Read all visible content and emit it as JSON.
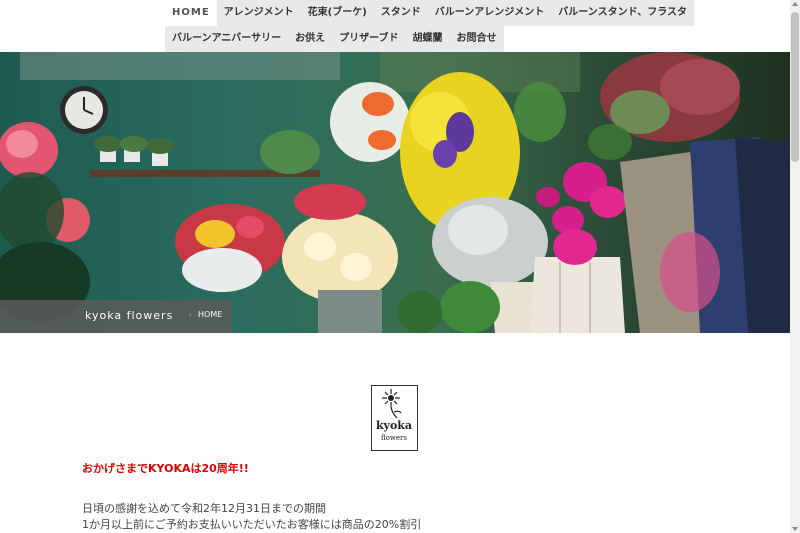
{
  "nav": {
    "row1": [
      "HOME",
      "アレンジメント",
      "花束(ブーケ)",
      "スタンド",
      "バルーンアレンジメント",
      "バルーンスタンド、フラスタ"
    ],
    "row2": [
      "バルーンアニバーサリー",
      "お供え",
      "プリザーブド",
      "胡蝶蘭",
      "お問合せ"
    ]
  },
  "hero": {
    "site_name": "kyoka flowers",
    "breadcrumb_home": "HOME"
  },
  "logo": {
    "line1": "kyoka",
    "line2": "flowers"
  },
  "content": {
    "anniversary": "おかげさまでKYOKAは20周年!!",
    "line1": "日頃の感謝を込めて令和2年12月31日までの期間",
    "line2": "1か月以上前にご予約お支払いいただいたお客様には商品の20%割引"
  }
}
